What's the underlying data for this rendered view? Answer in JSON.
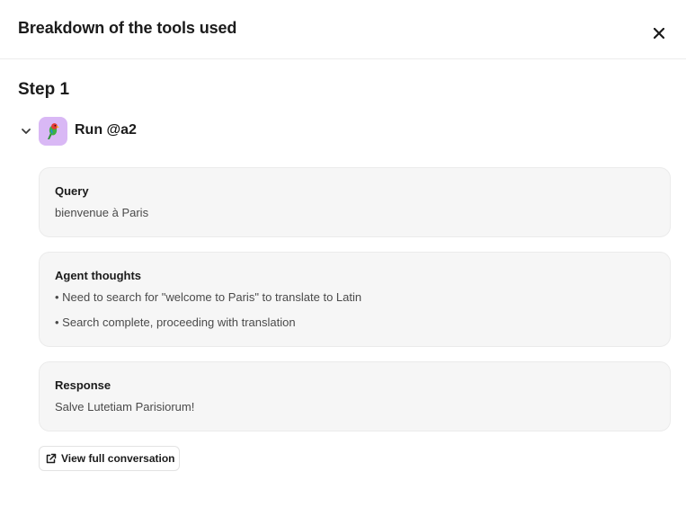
{
  "header": {
    "title": "Breakdown of the tools used",
    "close_icon": "close-icon"
  },
  "step": {
    "title": "Step 1"
  },
  "run": {
    "label": "Run @a2",
    "avatar_icon": "parrot-icon",
    "avatar_color": "#d9b8f5",
    "expanded": true
  },
  "query": {
    "title": "Query",
    "text": "bienvenue à Paris"
  },
  "thoughts": {
    "title": "Agent thoughts",
    "items": [
      "• Need to search for \"welcome to Paris\" to translate to Latin",
      "• Search complete, proceeding with translation"
    ]
  },
  "response": {
    "title": "Response",
    "text": "Salve Lutetiam Parisiorum!"
  },
  "footer": {
    "view_label": "View full conversation",
    "view_icon": "external-link-icon"
  }
}
